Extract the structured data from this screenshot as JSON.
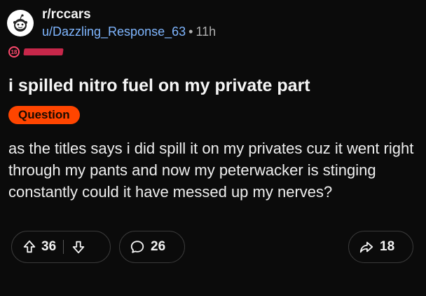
{
  "post": {
    "subreddit": "r/rccars",
    "username": "u/Dazzling_Response_63",
    "separator": "•",
    "age": "11h",
    "nsfw_badge": "18",
    "title": "i spilled nitro fuel on my private part",
    "flair": "Question",
    "body": "as the titles says i did spill it on my privates cuz it went right through my pants and now my peterwacker is stinging constantly could it have messed up my nerves?"
  },
  "actions": {
    "upvotes": "36",
    "comments": "26",
    "shares": "18"
  },
  "icons": {
    "avatar": "snoo-avatar-icon",
    "upvote": "arrow-up-icon",
    "downvote": "arrow-down-icon",
    "comment": "comment-bubble-icon",
    "share": "share-arrow-icon"
  },
  "colors": {
    "background": "#0b0b0b",
    "username": "#7fb6ff",
    "flair_bg": "#ff4500",
    "nsfw": "#ff4a6e"
  }
}
